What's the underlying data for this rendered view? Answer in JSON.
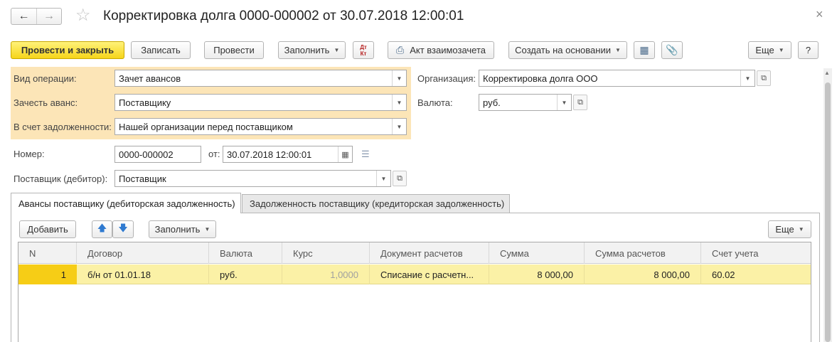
{
  "title": "Корректировка долга 0000-000002 от 30.07.2018 12:00:01",
  "nav": {
    "back_icon": "arrow-left-icon",
    "forward_icon": "arrow-right-icon",
    "star_icon": "star-icon"
  },
  "window": {
    "close": "×"
  },
  "toolbar": {
    "post_close": "Провести и закрыть",
    "save": "Записать",
    "post": "Провести",
    "fill": "Заполнить",
    "dt_kt": "Дт Кт",
    "act": "Акт взаимозачета",
    "create_based": "Создать на основании",
    "more": "Еще",
    "help": "?"
  },
  "fields": {
    "operation_type": {
      "label": "Вид операции:",
      "value": "Зачет авансов"
    },
    "offset_advance": {
      "label": "Зачесть аванс:",
      "value": "Поставщику"
    },
    "against_debt": {
      "label": "В счет задолженности:",
      "value": "Нашей организации перед поставщиком"
    },
    "organization": {
      "label": "Организация:",
      "value": "Корректировка долга ООО"
    },
    "currency": {
      "label": "Валюта:",
      "value": "руб."
    },
    "number": {
      "label": "Номер:",
      "value": "0000-000002"
    },
    "date": {
      "label": "от:",
      "value": "30.07.2018 12:00:01"
    },
    "supplier": {
      "label": "Поставщик (дебитор):",
      "value": "Поставщик"
    }
  },
  "tabs": [
    {
      "label": "Авансы поставщику (дебиторская задолженность)",
      "active": true
    },
    {
      "label": "Задолженность поставщику (кредиторская задолженность)",
      "active": false
    }
  ],
  "table_toolbar": {
    "add": "Добавить",
    "fill": "Заполнить",
    "more": "Еще"
  },
  "table": {
    "columns": [
      "N",
      "Договор",
      "Валюта",
      "Курс",
      "Документ расчетов",
      "Сумма",
      "Сумма расчетов",
      "Счет учета"
    ],
    "rows": [
      [
        "1",
        "б/н от 01.01.18",
        "руб.",
        "1,0000",
        "Списание с расчетн...",
        "8 000,00",
        "8 000,00",
        "60.02"
      ]
    ]
  },
  "colors": {
    "primary": "#f6d51a",
    "highlight_panel": "#fce5b7",
    "selected_row": "#fbf1a6",
    "row_marker": "#f6cd16"
  }
}
